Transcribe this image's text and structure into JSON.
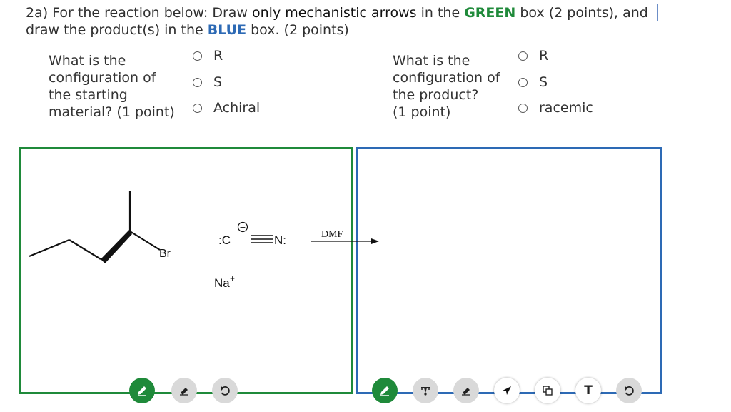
{
  "question": {
    "part1": "2a) For the reaction below: Draw ",
    "bold1": "only mechanistic arrows",
    "part2": " in the ",
    "green": "GREEN",
    "part3": " box (2 points), and draw the product(s) in the ",
    "blue": "BLUE",
    "part4": " box. (2 points)"
  },
  "q1": {
    "prompt_lines": [
      "What is the",
      "configuration of",
      "the starting",
      "material? (1 point)"
    ],
    "options": [
      "R",
      "S",
      "Achiral"
    ]
  },
  "q2": {
    "prompt_lines": [
      "What is the",
      "configuration of",
      "the product?",
      "(1 point)"
    ],
    "options": [
      "R",
      "S",
      "racemic"
    ]
  },
  "molecule": {
    "leaving_group": "Br",
    "cyanide_left": ":C",
    "cyanide_right": "N:",
    "charge_symbol": "−",
    "counterion": "Na",
    "counterion_charge": "+",
    "solvent": "DMF"
  },
  "colors": {
    "green": "#1f8a3a",
    "blue": "#2d6ab5"
  },
  "toolbar_green": [
    "pencil-icon",
    "eraser-icon",
    "undo-icon"
  ],
  "toolbar_blue": [
    "pencil-icon",
    "pin-icon",
    "eraser-icon",
    "arrow-icon",
    "shapes-icon",
    "text-icon",
    "undo-icon"
  ],
  "text_tool_label": "T"
}
